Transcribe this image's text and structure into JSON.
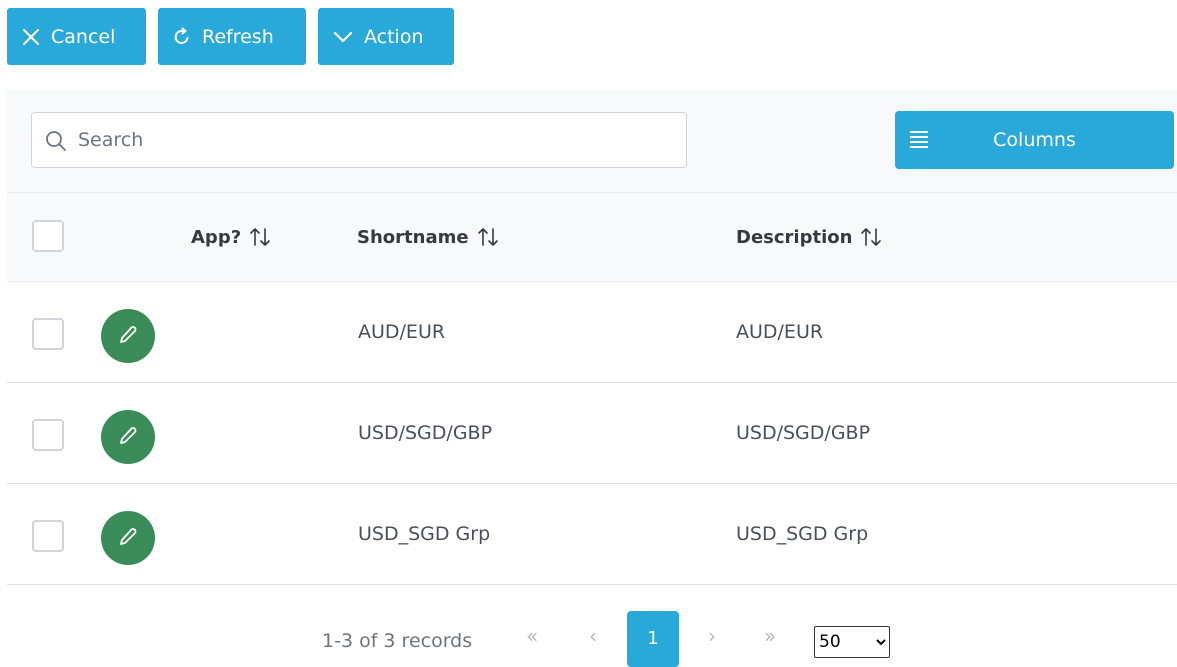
{
  "toolbar": {
    "cancel_label": "Cancel",
    "refresh_label": "Refresh",
    "action_label": "Action"
  },
  "search": {
    "placeholder": "Search",
    "value": ""
  },
  "columns_button": {
    "label": "Columns"
  },
  "table": {
    "headers": {
      "app": "App?",
      "shortname": "Shortname",
      "description": "Description"
    },
    "rows": [
      {
        "shortname": "AUD/EUR",
        "description": "AUD/EUR"
      },
      {
        "shortname": "USD/SGD/GBP",
        "description": "USD/SGD/GBP"
      },
      {
        "shortname": "USD_SGD Grp",
        "description": "USD_SGD Grp"
      }
    ]
  },
  "pagination": {
    "records_text": "1-3 of 3 records",
    "first": "«",
    "prev": "‹",
    "current_page": "1",
    "next": "›",
    "last": "»",
    "rows_per_page": "50",
    "rows_per_page_options": [
      "50"
    ]
  },
  "colors": {
    "primary": "#29a9d9",
    "edit": "#3a8c58",
    "header_bg": "#f8f9fa"
  },
  "icons": {
    "cancel": "close-icon",
    "refresh": "refresh-icon",
    "action": "chevron-down-icon",
    "search": "search-icon",
    "columns": "bars-icon",
    "sort": "sort-icon",
    "edit": "pencil-icon"
  }
}
